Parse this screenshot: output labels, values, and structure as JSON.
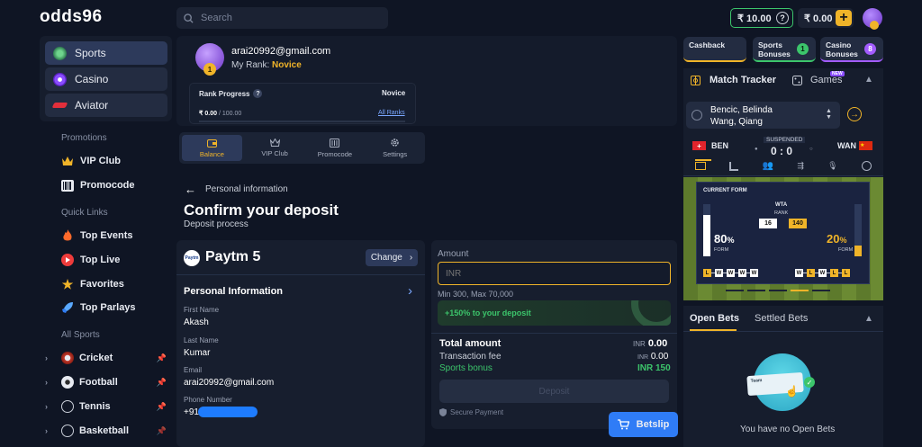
{
  "header": {
    "logo": "odds96",
    "search_placeholder": "Search",
    "wallet_real": "₹ 10.00",
    "wallet_bonus": "₹ 0.00",
    "help_glyph": "?",
    "plus_glyph": "+"
  },
  "sidebar": {
    "main": [
      {
        "label": "Sports",
        "icon": "sports-ball-icon"
      },
      {
        "label": "Casino",
        "icon": "casino-chip-icon"
      },
      {
        "label": "Aviator",
        "icon": "aviator-plane-icon"
      }
    ],
    "promotions_title": "Promotions",
    "promotions": [
      {
        "label": "VIP Club",
        "icon": "crown-icon"
      },
      {
        "label": "Promocode",
        "icon": "barcode-icon"
      }
    ],
    "quick_links_title": "Quick Links",
    "quick_links": [
      {
        "label": "Top Events",
        "icon": "fire-icon"
      },
      {
        "label": "Top Live",
        "icon": "live-play-icon"
      },
      {
        "label": "Favorites",
        "icon": "star-icon"
      },
      {
        "label": "Top Parlays",
        "icon": "rocket-icon"
      }
    ],
    "all_sports_title": "All Sports",
    "sports": [
      {
        "label": "Cricket",
        "icon": "cricket-icon"
      },
      {
        "label": "Football",
        "icon": "football-icon"
      },
      {
        "label": "Tennis",
        "icon": "tennis-icon"
      },
      {
        "label": "Basketball",
        "icon": "basketball-icon"
      }
    ]
  },
  "profile": {
    "email": "arai20992@gmail.com",
    "rank_prefix": "My Rank:",
    "rank": "Novice",
    "badge_number": "1",
    "rank_progress_label": "Rank Progress",
    "rank_progress_help": "?",
    "rank_target": "Novice",
    "progress_value": "₹ 0.00",
    "progress_total": "/ 100.00",
    "progress_fraction": 0,
    "all_ranks": "All Ranks"
  },
  "account_tabs": [
    {
      "label": "Balance",
      "icon": "wallet-icon",
      "active": true
    },
    {
      "label": "VIP Club",
      "icon": "crown-icon",
      "active": false
    },
    {
      "label": "Promocode",
      "icon": "promocode-icon",
      "active": false
    },
    {
      "label": "Settings",
      "icon": "gear-icon",
      "active": false
    }
  ],
  "deposit": {
    "back_label": "Personal information",
    "title": "Confirm your deposit",
    "subtitle": "Deposit process",
    "method": "Paytm 5",
    "method_logo_text": "Paytm",
    "change_label": "Change",
    "personal_info_title": "Personal Information",
    "fields": [
      {
        "label": "First Name",
        "value": "Akash"
      },
      {
        "label": "Last Name",
        "value": "Kumar"
      },
      {
        "label": "Email",
        "value": "arai20992@gmail.com"
      },
      {
        "label": "Phone Number",
        "value": "+91"
      }
    ],
    "amount_label": "Amount",
    "amount_placeholder": "INR",
    "amount_limits": "Min 300, Max 70,000",
    "bonus_text": "+150% to your deposit",
    "total_label": "Total amount",
    "total_currency": "INR",
    "total_value": "0.00",
    "fee_label": "Transaction fee",
    "fee_currency": "INR",
    "fee_value": "0.00",
    "sports_bonus_label": "Sports bonus",
    "sports_bonus_value": "INR 150",
    "deposit_button": "Deposit",
    "secure_payment": "Secure Payment"
  },
  "betslip_label": "Betslip",
  "right_panel": {
    "promos": [
      {
        "label": "Cashback",
        "count": "",
        "accent": "#f0b429"
      },
      {
        "label": "Sports Bonuses",
        "count": "1",
        "accent": "#3cc56b"
      },
      {
        "label": "Casino Bonuses",
        "count": "8",
        "accent": "#a35cff"
      }
    ],
    "match_tracker_label": "Match Tracker",
    "games_label": "Games",
    "games_badge": "NEW",
    "match_name_line1": "Bencic, Belinda",
    "match_name_line2": "Wang, Qiang",
    "team_home": "BEN",
    "team_away": "WAN",
    "status": "SUSPENDED",
    "score": "0 : 0",
    "current_form_label": "CURRENT FORM",
    "tour_label": "WTA",
    "rank_label": "RANK",
    "home_rank": "16",
    "away_rank": "140",
    "home_form_pct": "80",
    "away_form_pct": "20",
    "form_label": "FORM",
    "home_form_fraction": 0.8,
    "away_form_fraction": 0.2,
    "home_results": [
      "L",
      "W",
      "W",
      "W",
      "W"
    ],
    "away_results": [
      "W",
      "L",
      "W",
      "L",
      "L"
    ],
    "open_bets_tab": "Open Bets",
    "settled_bets_tab": "Settled Bets",
    "ticket_text": "Team",
    "empty_text": "You have no Open Bets"
  },
  "colors": {
    "accent": "#f0b429",
    "green": "#3cc56b",
    "purple": "#a35cff",
    "primary_button": "#2f7cf6",
    "bg": "#0f1524"
  }
}
